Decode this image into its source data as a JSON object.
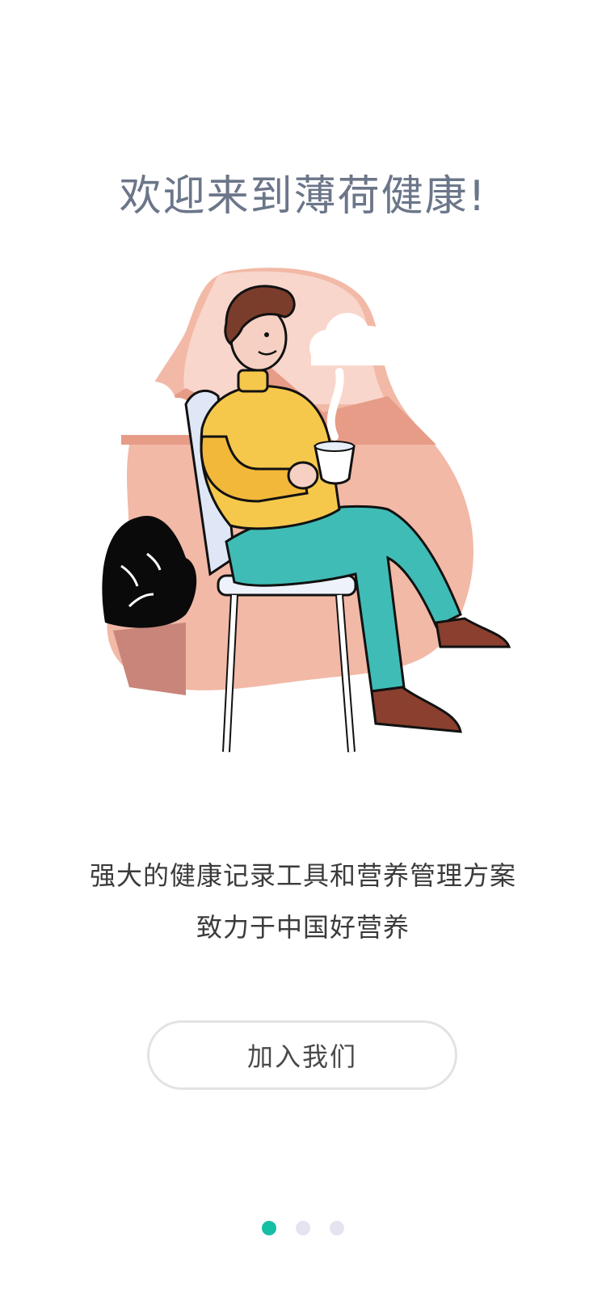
{
  "welcome": {
    "title": "欢迎来到薄荷健康!"
  },
  "illustration": {
    "icon": "man-sitting-with-coffee-illustration",
    "colors": {
      "blob": "#f2b9a6",
      "sweater": "#f5c84c",
      "pants": "#3fbcb6",
      "shoes": "#8a3f2f",
      "plant": "#0a0a0a"
    }
  },
  "description": {
    "line1": "强大的健康记录工具和营养管理方案",
    "line2": "致力于中国好营养"
  },
  "cta": {
    "join_label": "加入我们"
  },
  "pager": {
    "page_count": 3,
    "active_index": 0,
    "active_color": "#14bfa5",
    "inactive_color": "#e4e3f0"
  }
}
